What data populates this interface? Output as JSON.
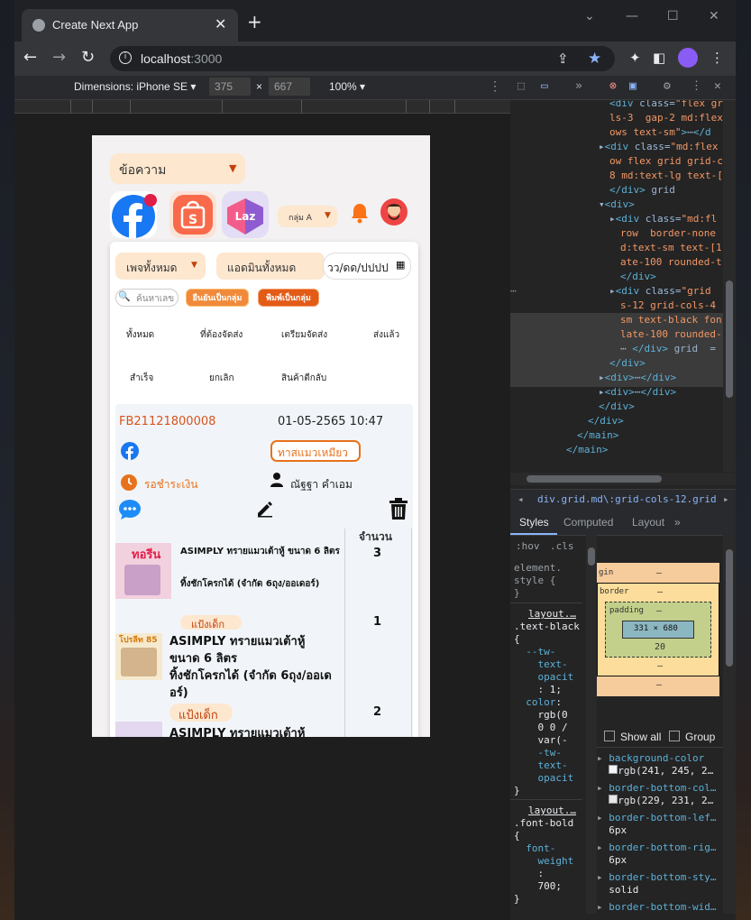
{
  "browser": {
    "tab_title": "Create Next App",
    "new_tab": "+",
    "url_host": "localhost",
    "url_port": ":3000"
  },
  "device_toolbar": {
    "dimensions_label": "Dimensions: iPhone SE ▾",
    "width": "375",
    "times": "×",
    "height": "667",
    "zoom": "100% ▾"
  },
  "app": {
    "message_select": "ข้อความ",
    "group_select": "กลุ่ม A",
    "page_select": "เพจทั้งหมด",
    "admin_select": "แอดมินทั้งหมด",
    "date_placeholder": "วว/ดด/ปปปป",
    "search_placeholder": "ค้นหาเลข",
    "confirm_group_btn": "ยืนยันเป็นกลุ่ม",
    "print_group_btn": "พิมพ์เป็นกลุ่ม",
    "status_tabs": [
      "ทั้งหมด",
      "ที่ต้องจัดส่ง",
      "เตรียมจัดส่ง",
      "ส่งแล้ว",
      "สำเร็จ",
      "ยกเลิก",
      "สินค้าตีกลับ"
    ],
    "order": {
      "id": "FB21121800008",
      "datetime": "01-05-2565 10:47",
      "customer_tag": "ทาสแมวเหมียว",
      "status": "รอชำระเงิน",
      "customer_name": "ณัฐฐา คำเอม",
      "qty_header": "จำนวน",
      "items": [
        {
          "name_line1": "ASIMPLY ทรายแมวเต้าหู้ ขนาด 6 ลิตร",
          "name_line2": "ทิ้งชักโครกได้ (จำกัด 6ถุง/ออเดอร์)",
          "variant": "แป้งเด็ก",
          "qty": "3"
        },
        {
          "name_line1": "ASIMPLY ทรายแมวเต้าหู้ ขนาด 6 ลิตร",
          "name_line2": "ทิ้งชักโครกได้ (จำกัด 6ถุง/ออเดอร์)",
          "variant": "แป้งเด็ก",
          "qty": "1"
        },
        {
          "name_line1": "ASIMPLY ทรายแมวเต้าหู้",
          "qty": "2"
        }
      ]
    }
  },
  "devtools": {
    "breadcrumb": "div.grid.md\\:grid-cols-12.grid-cols-4.",
    "panel_tabs": [
      "Styles",
      "Computed",
      "Layout"
    ],
    "filter_hov": ":hov",
    "filter_cls": ".cls",
    "box_content": "331 × 680",
    "box_padding_label": "padding",
    "box_border_label": "border",
    "box_margin_label": "gin",
    "box_padding_bottom": "20",
    "show_all": "Show all",
    "group": "Group",
    "computed": [
      {
        "prop": "background-color",
        "val": "rgb(241, 245, 2…"
      },
      {
        "prop": "border-bottom-col…",
        "val": "rgb(229, 231, 2…"
      },
      {
        "prop": "border-bottom-lef…",
        "val": "6px"
      },
      {
        "prop": "border-bottom-rig…",
        "val": "6px"
      },
      {
        "prop": "border-bottom-sty…",
        "val": "solid"
      },
      {
        "prop": "border-bottom-wid…",
        "val": ""
      }
    ]
  },
  "colors": {
    "accent_orange": "#e8721c",
    "select_bg": "#fde7cf",
    "order_id": "#d9531e",
    "facebook": "#1877f2"
  }
}
